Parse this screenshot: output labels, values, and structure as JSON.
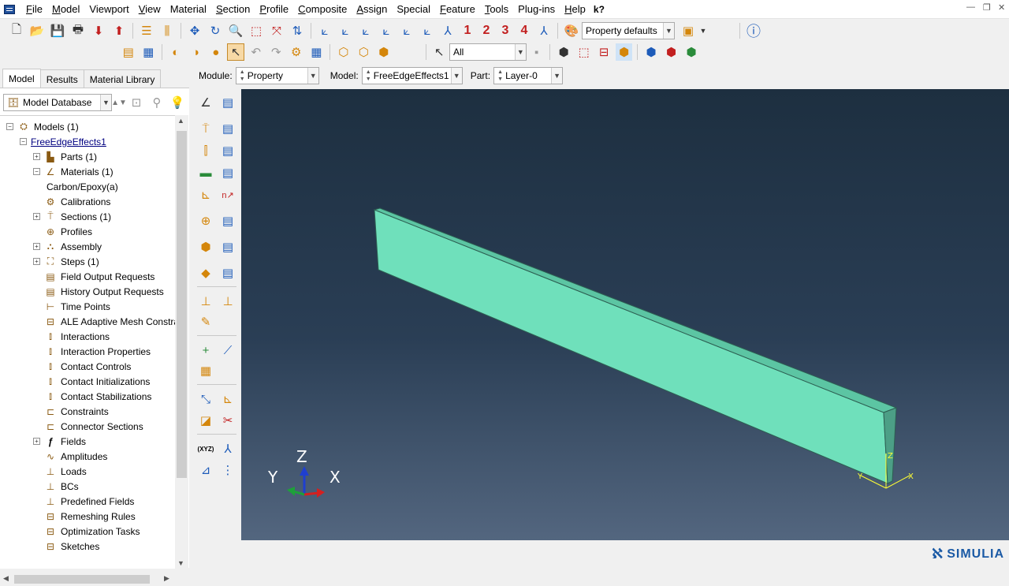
{
  "menubar": {
    "items": [
      {
        "label": "File",
        "key": "F",
        "rest": "ile"
      },
      {
        "label": "Model",
        "key": "M",
        "rest": "odel"
      },
      {
        "label": "Viewport",
        "key": "",
        "rest": "Viewport"
      },
      {
        "label": "View",
        "key": "V",
        "rest": "iew"
      },
      {
        "label": "Material",
        "key": "",
        "rest": "Material"
      },
      {
        "label": "Section",
        "key": "S",
        "rest": "ection"
      },
      {
        "label": "Profile",
        "key": "P",
        "rest": "rofile"
      },
      {
        "label": "Composite",
        "key": "C",
        "rest": "omposite"
      },
      {
        "label": "Assign",
        "key": "A",
        "rest": "ssign"
      },
      {
        "label": "Special",
        "key": "",
        "rest": "Special"
      },
      {
        "label": "Feature",
        "key": "F",
        "rest": "eature"
      },
      {
        "label": "Tools",
        "key": "T",
        "rest": "ools"
      },
      {
        "label": "Plug-ins",
        "key": "",
        "rest": "Plug-ins"
      },
      {
        "label": "Help",
        "key": "H",
        "rest": "elp"
      }
    ],
    "whats_this": "k?"
  },
  "toolbar": {
    "view_numbers": [
      "1",
      "2",
      "3",
      "4"
    ],
    "render_style": "Property defaults",
    "selection_filter": "All"
  },
  "context": {
    "module_label": "Module:",
    "module_value": "Property",
    "model_label": "Model:",
    "model_value": "FreeEdgeEffects1",
    "part_label": "Part:",
    "part_value": "Layer-0"
  },
  "left_panel": {
    "tabs": [
      "Model",
      "Results",
      "Material Library"
    ],
    "active_tab": "Model",
    "database_combo": "Model Database",
    "tree": [
      {
        "label": "Models (1)",
        "level": 0,
        "expander": "−",
        "icon": "models-icon"
      },
      {
        "label": "FreeEdgeEffects1",
        "level": 1,
        "expander": "−",
        "icon": "",
        "link": true
      },
      {
        "label": "Parts (1)",
        "level": 2,
        "expander": "+",
        "icon": "parts-icon"
      },
      {
        "label": "Materials (1)",
        "level": 2,
        "expander": "−",
        "icon": "materials-icon"
      },
      {
        "label": "Carbon/Epoxy(a)",
        "level": 3,
        "expander": "",
        "icon": ""
      },
      {
        "label": "Calibrations",
        "level": 2,
        "expander": "",
        "icon": "calibrations-icon"
      },
      {
        "label": "Sections (1)",
        "level": 2,
        "expander": "+",
        "icon": "sections-icon"
      },
      {
        "label": "Profiles",
        "level": 2,
        "expander": "",
        "icon": "profiles-icon"
      },
      {
        "label": "Assembly",
        "level": 2,
        "expander": "+",
        "icon": "assembly-icon"
      },
      {
        "label": "Steps (1)",
        "level": 2,
        "expander": "+",
        "icon": "steps-icon"
      },
      {
        "label": "Field Output Requests",
        "level": 2,
        "expander": "",
        "icon": "field-output-icon"
      },
      {
        "label": "History Output Requests",
        "level": 2,
        "expander": "",
        "icon": "history-output-icon"
      },
      {
        "label": "Time Points",
        "level": 2,
        "expander": "",
        "icon": "time-points-icon"
      },
      {
        "label": "ALE Adaptive Mesh Constra",
        "level": 2,
        "expander": "",
        "icon": "ale-mesh-icon"
      },
      {
        "label": "Interactions",
        "level": 2,
        "expander": "",
        "icon": "interactions-icon"
      },
      {
        "label": "Interaction Properties",
        "level": 2,
        "expander": "",
        "icon": "interaction-properties-icon"
      },
      {
        "label": "Contact Controls",
        "level": 2,
        "expander": "",
        "icon": "contact-controls-icon"
      },
      {
        "label": "Contact Initializations",
        "level": 2,
        "expander": "",
        "icon": "contact-init-icon"
      },
      {
        "label": "Contact Stabilizations",
        "level": 2,
        "expander": "",
        "icon": "contact-stab-icon"
      },
      {
        "label": "Constraints",
        "level": 2,
        "expander": "",
        "icon": "constraints-icon"
      },
      {
        "label": "Connector Sections",
        "level": 2,
        "expander": "",
        "icon": "connector-sections-icon"
      },
      {
        "label": "Fields",
        "level": 2,
        "expander": "+",
        "icon": "fields-icon"
      },
      {
        "label": "Amplitudes",
        "level": 2,
        "expander": "",
        "icon": "amplitudes-icon"
      },
      {
        "label": "Loads",
        "level": 2,
        "expander": "",
        "icon": "loads-icon"
      },
      {
        "label": "BCs",
        "level": 2,
        "expander": "",
        "icon": "bcs-icon"
      },
      {
        "label": "Predefined Fields",
        "level": 2,
        "expander": "",
        "icon": "predefined-fields-icon"
      },
      {
        "label": "Remeshing Rules",
        "level": 2,
        "expander": "",
        "icon": "remeshing-rules-icon"
      },
      {
        "label": "Optimization Tasks",
        "level": 2,
        "expander": "",
        "icon": "optimization-tasks-icon"
      },
      {
        "label": "Sketches",
        "level": 2,
        "expander": "",
        "icon": "sketches-icon"
      }
    ]
  },
  "toolbox": {
    "xyz_label": "(XYZ)"
  },
  "viewport": {
    "part_color": "#6fe0bb",
    "triad_labels": {
      "z": "Z",
      "y": "Y",
      "x": "X"
    },
    "local_axes": {
      "z": "Z",
      "y": "Y",
      "x": "X"
    }
  },
  "brand": "SIMULIA"
}
